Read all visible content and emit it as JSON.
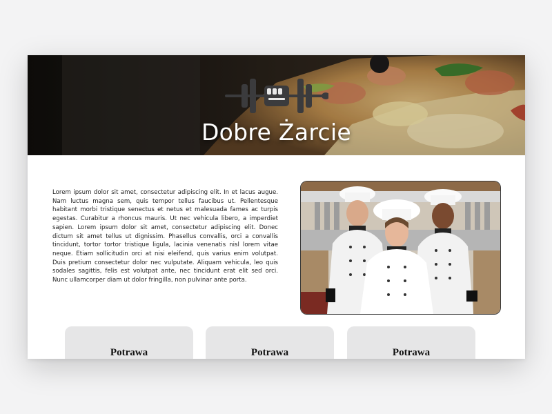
{
  "hero": {
    "title": "Dobre Żarcie",
    "logo_icon": "barbell-fist-icon"
  },
  "intro": {
    "text": "Lorem ipsum dolor sit amet, consectetur adipiscing elit. In et lacus augue. Nam luctus magna sem, quis tempor tellus faucibus ut. Pellentesque habitant morbi tristique senectus et netus et malesuada fames ac turpis egestas. Curabitur a rhoncus mauris. Ut nec vehicula libero, a imperdiet sapien. Lorem ipsum dolor sit amet, consectetur adipiscing elit. Donec dictum sit amet tellus ut dignissim. Phasellus convallis, orci a convallis tincidunt, tortor tortor tristique ligula, lacinia venenatis nisl lorem vitae neque. Etiam sollicitudin orci at nisi eleifend, quis varius enim volutpat. Duis pretium consectetur dolor nec vulputate. Aliquam vehicula, leo quis sodales sagittis, felis est volutpat ante, nec tincidunt erat elit sed orci. Nunc ullamcorper diam ut dolor fringilla, non pulvinar ante porta."
  },
  "cards": [
    {
      "title": "Potrawa"
    },
    {
      "title": "Potrawa"
    },
    {
      "title": "Potrawa"
    }
  ],
  "colors": {
    "page_background": "#f3f3f4",
    "card_background": "#e6e6e7",
    "hero_title": "#ffffff"
  }
}
